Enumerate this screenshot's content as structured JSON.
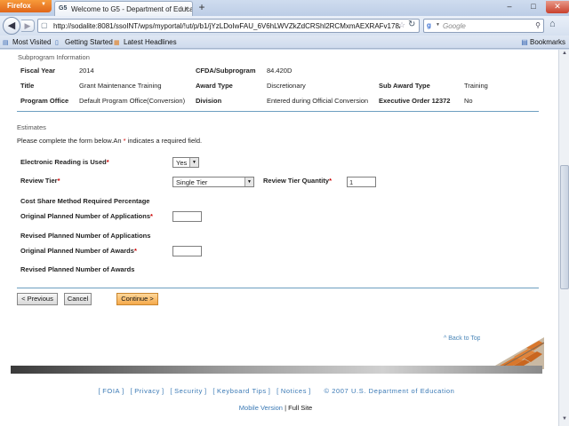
{
  "browser": {
    "app_button": "Firefox",
    "tab_title": "Welcome to G5 - Department of Educati...",
    "tab_favicon": "G5",
    "url": "http://sodalite:8081/ssoINT/wps/myportal/!ut/p/b1/jYzLDoIwFAU_6V6hLWVZkZdCRShl2RCMxmAEXRAFv178AKN",
    "search_placeholder": "Google",
    "bookmarks": [
      "Most Visited",
      "Getting Started",
      "Latest Headlines"
    ],
    "bookmarks_menu": "Bookmarks"
  },
  "subprogram": {
    "heading": "Subprogram Information",
    "fiscal_year_label": "Fiscal Year",
    "fiscal_year": "2014",
    "cfda_label": "CFDA/Subprogram",
    "cfda": "84.420D",
    "title_label": "Title",
    "title": "Grant Maintenance Training",
    "award_type_label": "Award Type",
    "award_type": "Discretionary",
    "sub_award_type_label": "Sub Award Type",
    "sub_award_type": "Training",
    "program_office_label": "Program Office",
    "program_office": "Default Program Office(Conversion)",
    "division_label": "Division",
    "division": "Entered during Official Conversion",
    "exec_order_label": "Executive Order 12372",
    "exec_order": "No"
  },
  "estimates": {
    "heading": "Estimates",
    "instructions_prefix": "Please complete the form below.An",
    "instructions_star": "*",
    "instructions_suffix": "indicates a required field.",
    "electronic_reading_label": "Electronic Reading is Used",
    "electronic_reading_value": "Yes",
    "review_tier_label": "Review Tier",
    "review_tier_value": "Single Tier",
    "review_tier_qty_label": "Review Tier Quantity",
    "review_tier_qty_value": "1",
    "cost_share_label": "Cost Share Method Required Percentage",
    "orig_apps_label": "Original Planned Number of Applications",
    "orig_apps_value": "",
    "revised_apps_label": "Revised Planned Number of Applications",
    "orig_awards_label": "Original Planned Number of Awards",
    "orig_awards_value": "",
    "revised_awards_label": "Revised Planned Number of Awards",
    "required_mark": "*"
  },
  "actions": {
    "previous": "< Previous",
    "cancel": "Cancel",
    "continue": "Continue >"
  },
  "footer": {
    "back_to_top": "^ Back to Top",
    "links": [
      "FOIA",
      "Privacy",
      "Security",
      "Keyboard Tips",
      "Notices"
    ],
    "copyright": "© 2007 U.S. Department of Education",
    "mobile_version": "Mobile Version",
    "divider": "|",
    "full_site": "Full Site"
  },
  "colors": {
    "rule": "#6d9fc0",
    "link": "#3a79b5",
    "required": "#cc0000",
    "continue_button": "#f5a94a"
  }
}
